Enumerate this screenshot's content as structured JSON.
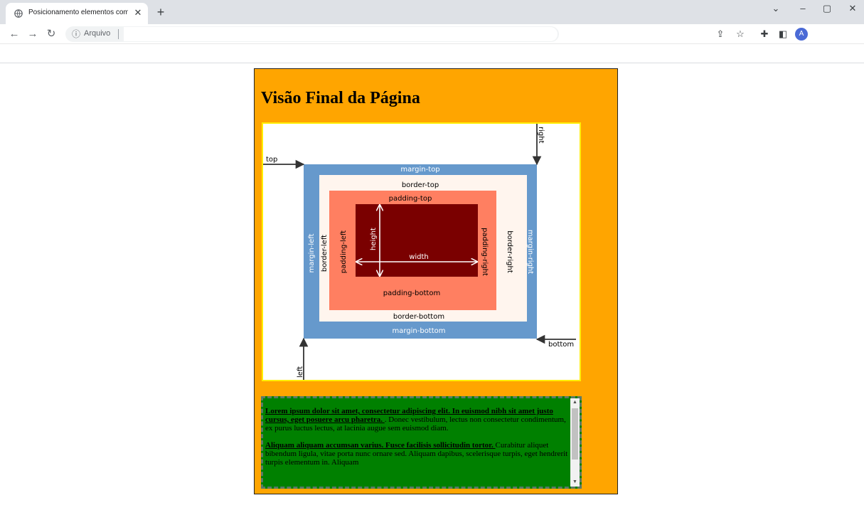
{
  "browser": {
    "tab_title": "Posicionamento elementos com",
    "address_protocol": "Arquivo",
    "avatar_initial": "A"
  },
  "page": {
    "heading": "Visão Final da Página"
  },
  "box_model": {
    "labels": {
      "top": "top",
      "right": "right",
      "bottom": "bottom",
      "left": "left",
      "margin_top": "margin-top",
      "margin_bottom": "margin-bottom",
      "margin_left": "margin-left",
      "margin_right": "margin-right",
      "border_top": "border-top",
      "border_bottom": "border-bottom",
      "border_left": "border-left",
      "border_right": "border-right",
      "padding_top": "padding-top",
      "padding_bottom": "padding-bottom",
      "padding_left": "padding-left",
      "padding_right": "padding-right",
      "width": "width",
      "height": "height"
    },
    "colors": {
      "margin": "#6699cc",
      "border": "#fff5ee",
      "padding": "#ff7f61",
      "content": "#7a0000"
    }
  },
  "textbox": {
    "p1_lead": "Lorem ipsum dolor sit amet, consectetur adipiscing elit. In euismod nibh sit amet justo cursus, eget posuere arcu pharetra. ",
    "p1_rest": ". Donec vestibulum, lectus non consectetur condimentum, ex purus luctus lectus, at lacinia augue sem euismod diam.",
    "p2_lead": "Aliquam aliquam accumsan varius. Fusce facilisis sollicitudin tortor. ",
    "p2_rest": "Curabitur aliquet bibendum ligula, vitae porta nunc ornare sed. Aliquam dapibus, scelerisque turpis, eget hendrerit turpis elementum in. Aliquam"
  }
}
